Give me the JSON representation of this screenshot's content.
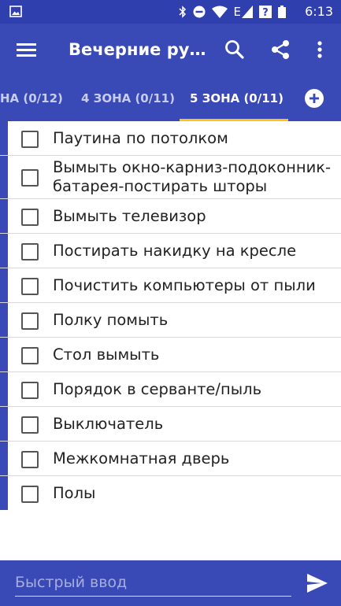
{
  "status_bar": {
    "time": "6:13",
    "icons": [
      "image-icon",
      "bluetooth-icon",
      "do-not-disturb-icon",
      "wifi-icon",
      "signal-e-icon",
      "signal-question-icon",
      "battery-icon"
    ],
    "network_label": "E"
  },
  "appbar": {
    "title": "Вечерние рут…",
    "icons": [
      "menu-icon",
      "search-icon",
      "share-icon",
      "more-vert-icon"
    ]
  },
  "tabs": [
    {
      "label": "НА (0/12)",
      "active": false
    },
    {
      "label": "4 ЗОНА (0/11)",
      "active": false
    },
    {
      "label": "5 ЗОНА (0/11)",
      "active": true
    }
  ],
  "add_tab_icon": "add-circle-icon",
  "tasks": [
    {
      "label": "Паутина по потолком",
      "checked": false
    },
    {
      "label": "Вымыть окно-карниз-подоконник-батарея-постирать шторы",
      "checked": false
    },
    {
      "label": "Вымыть телевизор",
      "checked": false
    },
    {
      "label": "Постирать накидку на кресле",
      "checked": false
    },
    {
      "label": "Почистить компьютеры от пыли",
      "checked": false
    },
    {
      "label": "Полку помыть",
      "checked": false
    },
    {
      "label": "Стол вымыть",
      "checked": false
    },
    {
      "label": "Порядок в серванте/пыль",
      "checked": false
    },
    {
      "label": "Выключатель",
      "checked": false
    },
    {
      "label": "Межкомнатная дверь",
      "checked": false
    },
    {
      "label": "Полы",
      "checked": false
    }
  ],
  "quick_entry": {
    "placeholder": "Быстрый ввод",
    "value": ""
  },
  "colors": {
    "primary": "#3949b5",
    "status_bar": "#2f3fae",
    "tab_indicator": "#ffc21b"
  }
}
